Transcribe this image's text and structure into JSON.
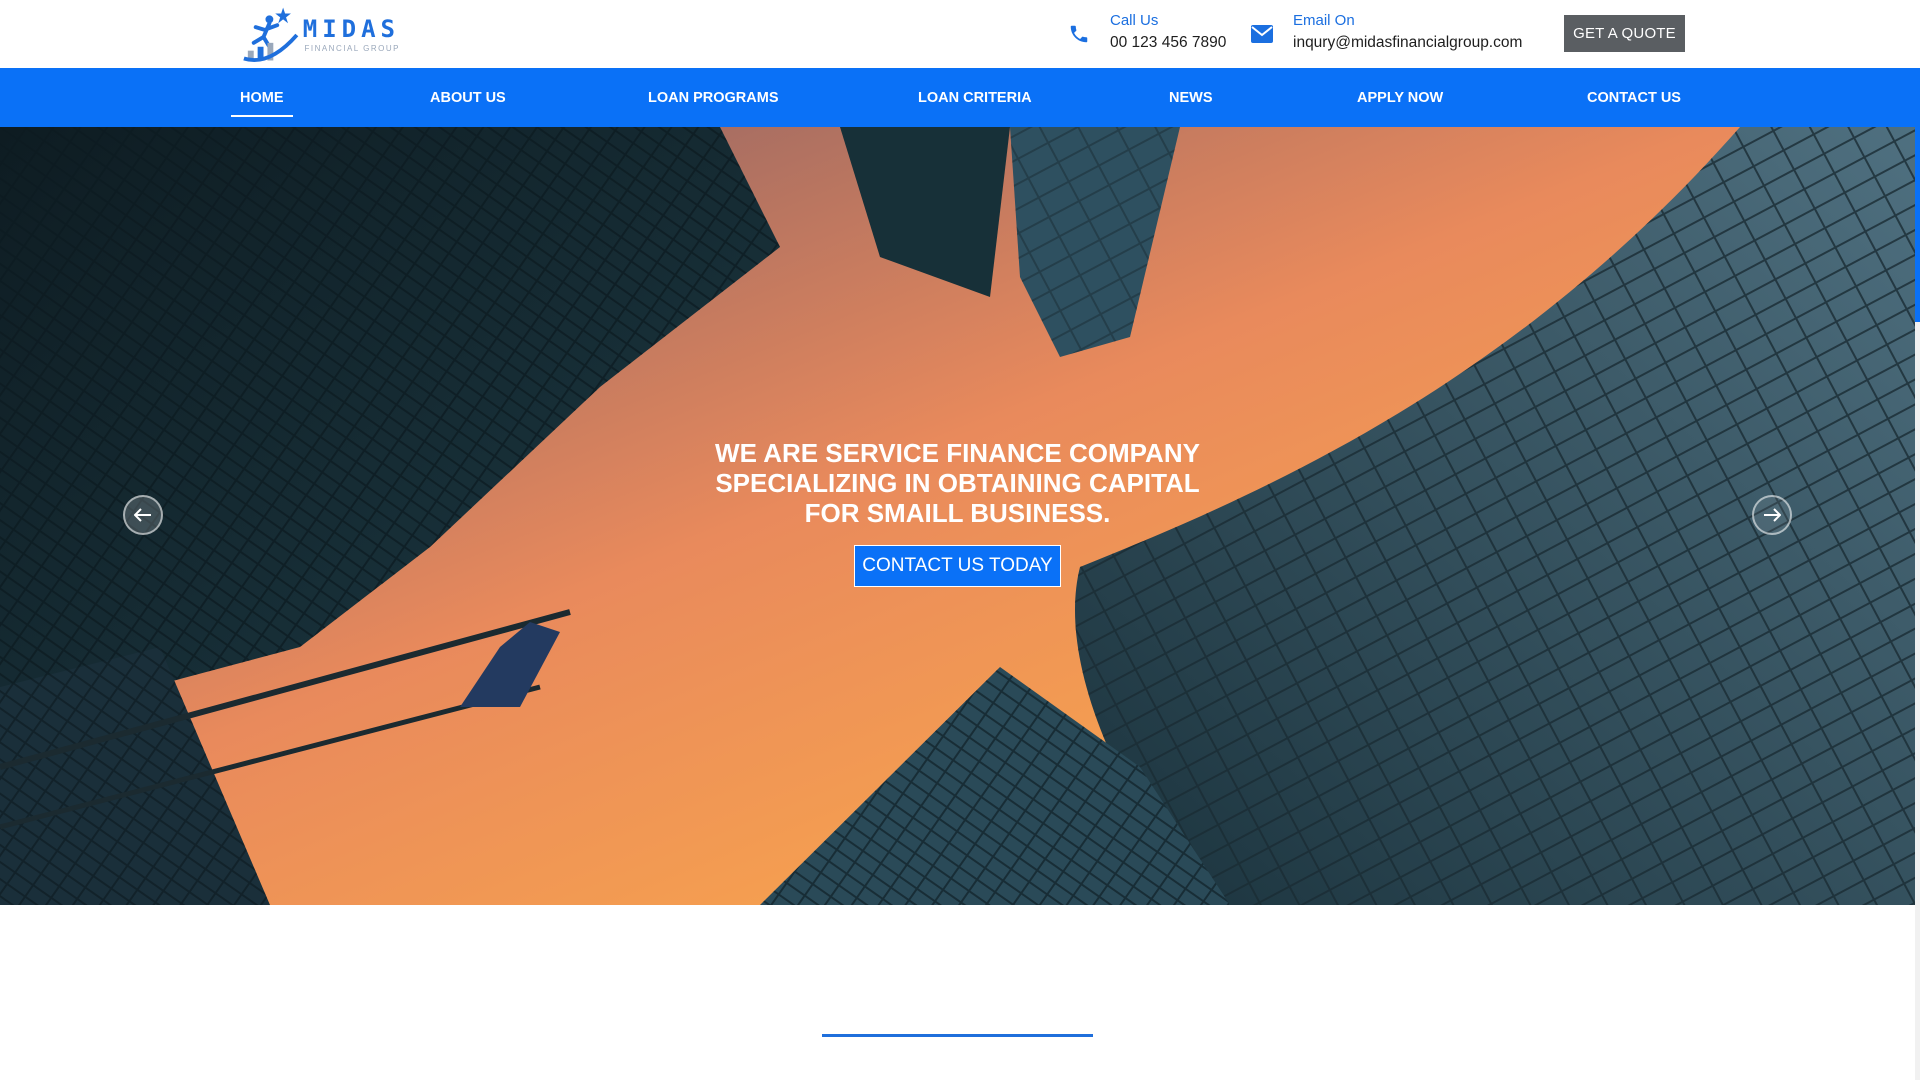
{
  "brand": {
    "name": "MIDAS",
    "tagline": "FINANCIAL GROUP",
    "color": "#1f6fdc"
  },
  "header": {
    "call": {
      "label": "Call Us",
      "value": "00 123 456 7890",
      "icon": "phone-icon"
    },
    "email": {
      "label": "Email On",
      "value": "inqury@midasfinancialgroup.com",
      "icon": "envelope-icon"
    },
    "quote_button": "GET A QUOTE"
  },
  "nav": {
    "accent": "#0a71f7",
    "items": [
      {
        "label": "HOME",
        "active": true
      },
      {
        "label": "ABOUT US",
        "active": false
      },
      {
        "label": "LOAN PROGRAMS",
        "active": false
      },
      {
        "label": "LOAN CRITERIA",
        "active": false
      },
      {
        "label": "NEWS",
        "active": false
      },
      {
        "label": "APPLY NOW",
        "active": false
      },
      {
        "label": "CONTACT US",
        "active": false
      }
    ]
  },
  "hero": {
    "title_lines": [
      "WE ARE SERVICE FINANCE COMPANY",
      "SPECIALIZING IN OBTAINING CAPITAL",
      "FOR SMAILL BUSINESS."
    ],
    "cta": "CONTACT US TODAY",
    "prev_icon": "arrow-left-icon",
    "next_icon": "arrow-right-icon"
  }
}
